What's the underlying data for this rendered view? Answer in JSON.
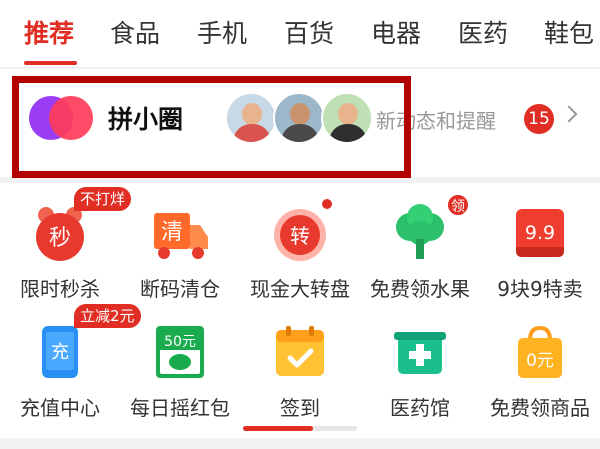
{
  "tabs": [
    {
      "label": "推荐",
      "active": true
    },
    {
      "label": "食品"
    },
    {
      "label": "手机"
    },
    {
      "label": "百货"
    },
    {
      "label": "电器"
    },
    {
      "label": "医药"
    },
    {
      "label": "鞋包"
    }
  ],
  "circle": {
    "title": "拼小圈",
    "note": "新动态和提醒",
    "count": "15"
  },
  "grid": {
    "row1": [
      {
        "label": "限时秒杀",
        "icon_text": "秒",
        "tag": "不打烊",
        "icon": "alarm-clock-icon"
      },
      {
        "label": "断码清仓",
        "icon_text": "清",
        "icon": "truck-icon"
      },
      {
        "label": "现金大转盘",
        "icon_text": "转",
        "icon": "wheel-icon"
      },
      {
        "label": "免费领水果",
        "icon": "tree-icon",
        "tag": "领"
      },
      {
        "label": "9块9特卖",
        "icon_text": "9.9",
        "icon": "price-tag-icon"
      }
    ],
    "row2": [
      {
        "label": "充值中心",
        "icon_text": "充",
        "tag": "立减2元",
        "icon": "phone-icon"
      },
      {
        "label": "每日摇红包",
        "icon_text": "50元",
        "icon": "red-packet-icon"
      },
      {
        "label": "签到",
        "icon": "calendar-check-icon"
      },
      {
        "label": "医药馆",
        "icon": "medicine-box-icon"
      },
      {
        "label": "免费领商品",
        "icon_text": "0元",
        "icon": "shopping-bag-icon"
      }
    ]
  },
  "colors": {
    "accent": "#e02e24",
    "highlight": "#b30000"
  }
}
